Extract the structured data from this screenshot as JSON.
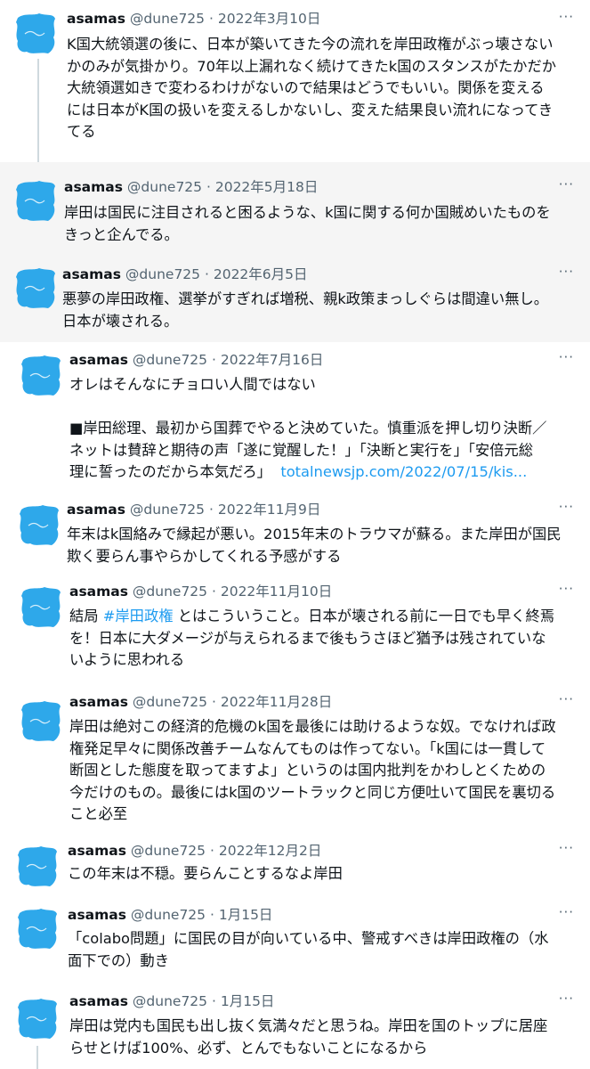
{
  "author": {
    "name": "asamas",
    "handle": "@dune725",
    "dot": "·"
  },
  "more_label": "···",
  "tweets": [
    {
      "date": "2022年3月10日",
      "lines": [
        "K国大統領選の後に、日本が築いてきた今の流れを岸田政権がぶっ壊さない",
        "かのみが気掛かり。70年以上漏れなく続けてきたk国のスタンスがたかだか",
        "大統領選如きで変わるわけがないので結果はどうでもいい。関係を変える",
        "には日本がK国の扱いを変えるしかないし、変えた結果良い流れになってき",
        "てる"
      ]
    },
    {
      "date": "2022年5月18日",
      "lines": [
        "岸田は国民に注目されると困るような、k国に関する何か国賊めいたものを",
        "きっと企んでる。"
      ]
    },
    {
      "date": "2022年6月5日",
      "lines": [
        "悪夢の岸田政権、選挙がすぎれば増税、親k政策まっしぐらは間違い無し。",
        "日本が壊される。"
      ]
    },
    {
      "date": "2022年7月16日",
      "lines": [
        "オレはそんなにチョロい人間ではない",
        "",
        "■岸田総理、最初から国葬でやると決めていた。慎重派を押し切り決断／",
        "ネットは賛辞と期待の声「遂に覚醒した！」「決断と実行を」「安倍元総",
        "理に誓ったのだから本気だろ」"
      ],
      "link": "totalnewsjp.com/2022/07/15/kis..."
    },
    {
      "date": "2022年11月9日",
      "lines": [
        "年末はk国絡みで縁起が悪い。2015年末のトラウマが蘇る。また岸田が国民",
        "欺く要らん事やらかしてくれる予感がする"
      ]
    },
    {
      "date": "2022年11月10日",
      "first_prefix": "結局 ",
      "hashtag": "#岸田政権",
      "first_suffix": " とはこういうこと。日本が壊される前に一日でも早く終焉",
      "lines": [
        "を！日本に大ダメージが与えられるまで後もうさほど猶予は残されていな",
        "いように思われる"
      ]
    },
    {
      "date": "2022年11月28日",
      "lines": [
        "岸田は絶対この経済的危機のk国を最後には助けるような奴。でなければ政",
        "権発足早々に関係改善チームなんてものは作ってない。「k国には一貫して",
        "断固とした態度を取ってますよ」というのは国内批判をかわしとくための",
        "今だけのもの。最後にはk国のツートラックと同じ方便吐いて国民を裏切る",
        "こと必至"
      ]
    },
    {
      "date": "2022年12月2日",
      "lines": [
        "この年末は不穏。要らんことするなよ岸田"
      ]
    },
    {
      "date": "1月15日",
      "lines": [
        "「colabo問題」に国民の目が向いている中、警戒すべきは岸田政権の（水",
        "面下での）動き"
      ]
    },
    {
      "date": "1月15日",
      "lines": [
        "岸田は党内も国民も出し抜く気満々だと思うね。岸田を国のトップに居座",
        "らせとけば100%、必ず、とんでもないことになるから"
      ]
    }
  ]
}
